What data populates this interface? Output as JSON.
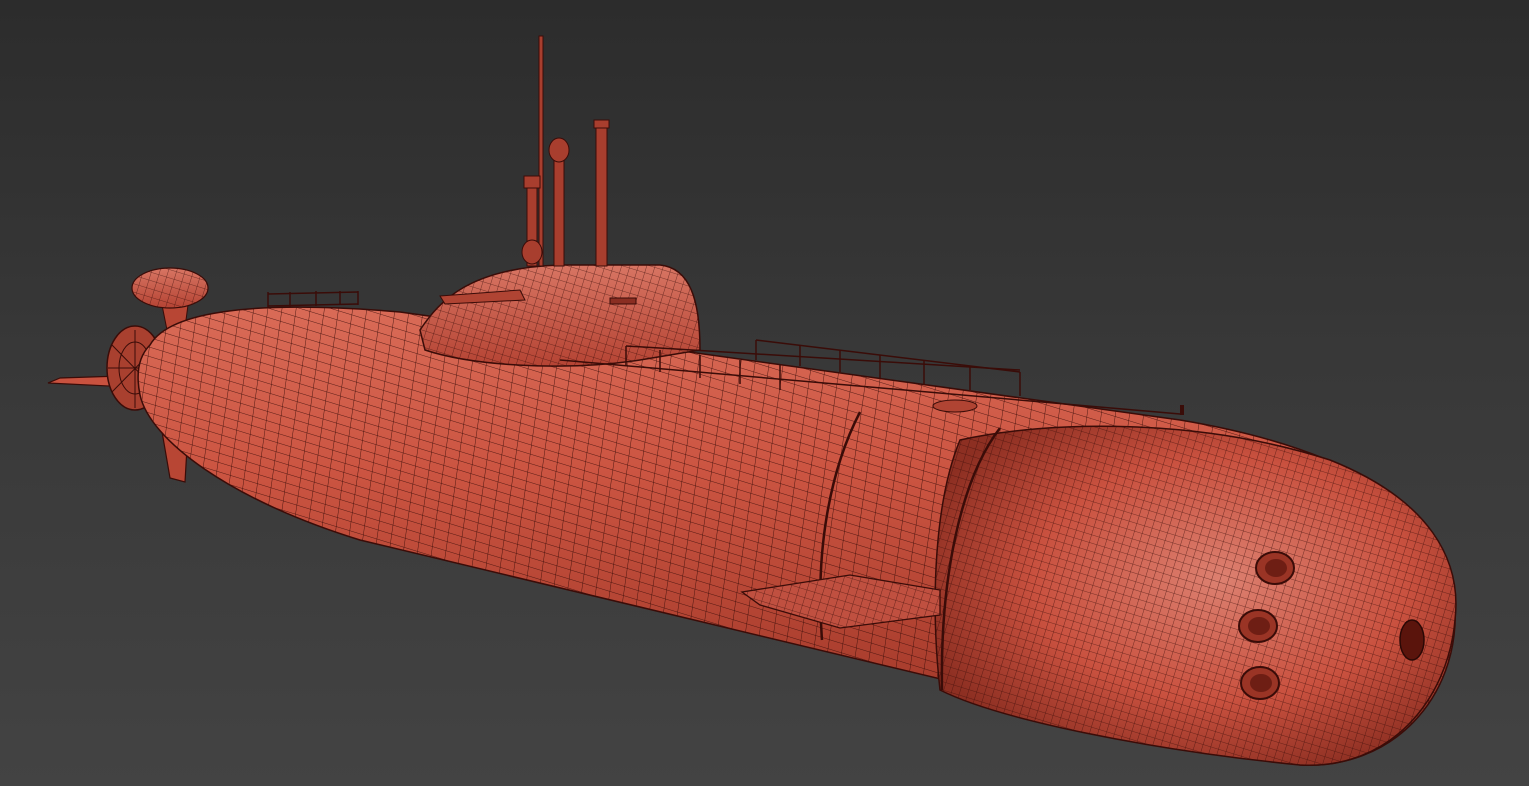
{
  "viewport": {
    "background_top": "#2c2c2c",
    "background_bottom": "#434343"
  },
  "model": {
    "subject": "submarine",
    "render_style": "wireframe-on-shaded",
    "hull_color": "#c8503e",
    "hull_highlight": "#d86a56",
    "hull_shadow": "#8a2e22",
    "wire_color": "#3a0c08",
    "torpedo_tube_count": 3
  }
}
